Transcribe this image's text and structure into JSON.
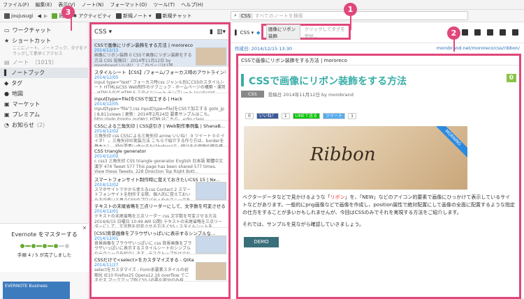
{
  "menu": [
    "ファイル(F)",
    "編集(E)",
    "表示(V)",
    "ノート(N)",
    "フォーマット(O)",
    "ツール(T)",
    "ヘルプ(H)"
  ],
  "toolbar": {
    "user": "joujusugi",
    "sync": "同期",
    "activity": "アクティビティ",
    "new_note": "新規ノート",
    "new_chat": "新規チャット",
    "search_chip": "CSS",
    "search_placeholder": "すべてのノートを検索"
  },
  "sidebar": {
    "workchat": "ワークチャット",
    "shortcuts": "ショートカット",
    "shortcuts_hint": "ここにノート、ノートブック、タグをドラッグして素早くアクセス",
    "notes": "ノート",
    "notes_count": "（1015）",
    "notebooks": "ノートブック",
    "tags": "タグ",
    "atlas": "地図",
    "market": "マーケット",
    "premium": "プレミアム",
    "notifications": "お知らせ",
    "notif_count": "(2)"
  },
  "promo": {
    "title": "Evernote をマスターする",
    "progress": "手順 4 / 5 が完了しました",
    "banner": "EVERNOTE Business"
  },
  "notelist": {
    "header": "CSS",
    "notes": [
      {
        "title": "CSSで画像にリボン装飾をする方法 | mororeco",
        "date": "2014/12/15",
        "snippet": "画像にリボン装飾 0 CSSで画像にリボン装飾をする方法 CSS 投稿日：2014年11月12日 by morobrand いいね！ 1 このページは1回...",
        "thumb": true
      },
      {
        "title": "スタイルシート【CSS】/フォーム/フォーカス時のアウトラインを指定する - T...",
        "date": "2014/12/05",
        "snippet": "input type=\"text\" フォーカス時css ジャンル別にCSSのスタイルシート HTML&CSS Web制作のテクニック - ホームページの構築・運用 - HTML5タグ HTML5 スタイルシート テンプレート JavaScript ...",
        "thumb": false
      },
      {
        "title": "input[type=file]をCSSで加工する | Hack",
        "date": "2014/12/05",
        "snippet": "input[type=\"file\"] css input[type=file]をCSSで加工する goto_jp | 8,811views | 更新：2014年2月24日 要素サンプルはこち。http://jsdo.it/goto_jp/rWcL HTMLはこちら。<div class...",
        "thumb": false
      },
      {
        "title": "CSSによる三角矢印 | CSS逆引き | Web制作事例集 | ShanaB...",
        "date": "2014/12/02",
        "snippet": "三角矢印 css CSSによる三角矢印 arrow いいね！ 0 ツイート 0 0 イイネ！ 。三角矢印の実装方法 こちらで紹介する作り方は、borderを基本とし、疑似要素(:afterまたはbefore)で、線はその周囲の幅を確保する...",
        "thumb": false
      },
      {
        "title": "CSS triangle generator",
        "date": "2014/12/02",
        "snippet": "c css3 三角矢印 CSS triangle generator English 日本語 繁體中文 漢字 474 Tweet 577 This page has been shared 577 times. View these Tweets. 228 Direction Top Right Bott...",
        "thumb": false
      },
      {
        "title": "スマートフォンサイト制作時に覚えておきたいCSS 15 | Nx...",
        "date": "2014/12/02",
        "snippet": "スマホサイトでやから使えるcss Contact 2 スマートフォンサイトを制作する際、個人的に覚えておいた方が良いと思うCSSのプロパティやテクニックをまとめてみました。...",
        "thumb": true
      },
      {
        "title": "テキストの末尾省略を三点リーダーにして、文字数を可変させる方法 - スタイル...",
        "date": "2014/12/01",
        "snippet": "テキストの末尾省略を三点リーダー css 文字数を可変させる方法 2014/6/15 日曜日 10:49 AM 公開) テキストの末尾省略を三点リーダーにして、文字数を可変させる方法 CSS・スタイルシートを...",
        "thumb": false
      },
      {
        "title": "[CSS]背景画像をブラウザいっぱいに表示するシンプルな...",
        "date": "2014/12/01",
        "snippet": "背景画像をブラウザいっぱいに css 背景画像をブラウザいっぱいに表示するスタイルシートのシンプルなテクニックを紹介します。デスクトップだけでなく、スマフォやタブレット...",
        "thumb": true
      },
      {
        "title": "CSSだけで<select>をカスタマイズする - Qiita",
        "date": "2014/11/27",
        "snippet": "selectをカスタマイズ - Form系要素スタイルの初期化 IE10 Firefox25 Opera12.16 overflow でごまかす マークアップ例 CSS (必要な部分のみ抜粋)...",
        "thumb": true
      }
    ]
  },
  "editor": {
    "notebook": "CSS",
    "tag_chip": "画像にリボン装飾",
    "tag_hint": "クリックしてタグを追加...",
    "created": "作成日: 2014/12/15 13:30",
    "source_url": "morobrand.net/mororeco/css/ribbon/",
    "content_title": "CSSで画像にリボン装飾をする方法 | mororeco",
    "post_title": "CSSで画像にリボン装飾をする方法",
    "post_count": "0",
    "category": "CSS",
    "post_meta": "投稿日 2014年11月12日 by morobrand",
    "share": [
      "0",
      "いいね！",
      "1",
      "LINEで送る",
      "ツイート",
      "1"
    ],
    "hero_text": "Ribbon",
    "ribbon": "MORNING",
    "para1_a": "ベクターデータなどで見かけるような「",
    "para1_red": "リボン",
    "para1_b": "」を、「NEW」などのアイコン的要素で画像にひっかけて表示しているサイトなどがあります。一般的にpng画像などで画像を作成し、position属性で絶対配置にして画像の全面に配置するような指定の仕方をすることが多いかもしれませんが、今回はCSSのみでそれを実現する方法をご紹介します。",
    "para2": "それでは、サンプルを見ながら確認していきましょう。",
    "demo": "DEMO"
  },
  "callouts": [
    "1",
    "2",
    "3"
  ],
  "colors": {
    "accent": "#e0477a",
    "teal": "#3aaea8",
    "link": "#2a8ae0"
  }
}
